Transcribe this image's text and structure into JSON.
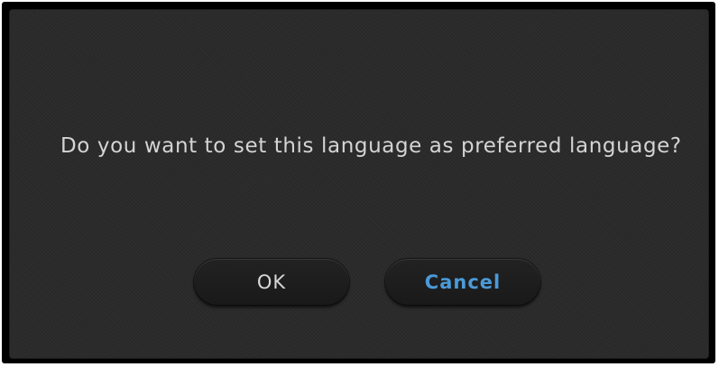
{
  "dialog": {
    "message": "Do you want to set this language as preferred language?",
    "buttons": {
      "ok_label": "OK",
      "cancel_label": "Cancel"
    }
  },
  "colors": {
    "dialog_background": "#2a2a2a",
    "message_text": "#d4d4d4",
    "ok_text": "#d8d8d8",
    "cancel_text": "#4b9ad8"
  }
}
